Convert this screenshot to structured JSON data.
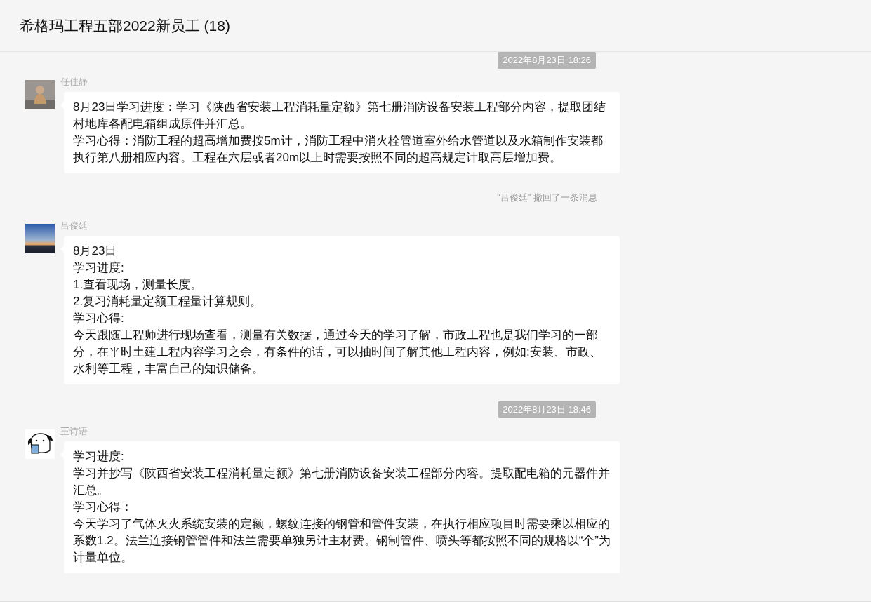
{
  "window": {
    "title": "希格玛工程五部2022新员工 (18)"
  },
  "messages": [
    {
      "kind": "time",
      "text": "2022年8月23日 18:26"
    },
    {
      "kind": "message",
      "sender": "任佳静",
      "lines": [
        "8月23日学习进度：学习《陕西省安装工程消耗量定额》第七册消防设备安装工程部分内容，提取团结村地库各配电箱组成原件并汇总。",
        "学习心得：消防工程的超高增加费按5m计，消防工程中消火栓管道室外给水管道以及水箱制作安装都执行第八册相应内容。工程在六层或者20m以上时需要按照不同的超高规定计取高层增加费。"
      ]
    },
    {
      "kind": "notice",
      "text": "\"吕俊廷\" 撤回了一条消息"
    },
    {
      "kind": "message",
      "sender": "吕俊廷",
      "lines": [
        "8月23日",
        "学习进度:",
        "1.查看现场，测量长度。",
        "2.复习消耗量定额工程量计算规则。",
        "学习心得:",
        "今天跟随工程师进行现场查看，测量有关数据，通过今天的学习了解，市政工程也是我们学习的一部分，在平时土建工程内容学习之余，有条件的话，可以抽时间了解其他工程内容，例如:安装、市政、水利等工程，丰富自己的知识储备。"
      ]
    },
    {
      "kind": "time",
      "text": "2022年8月23日 18:46"
    },
    {
      "kind": "message",
      "sender": "王诗语",
      "lines": [
        "学习进度:",
        "学习并抄写《陕西省安装工程消耗量定额》第七册消防设备安装工程部分内容。提取配电箱的元器件并汇总。",
        "学习心得：",
        "今天学习了气体灭火系统安装的定额，螺纹连接的钢管和管件安装，在执行相应项目时需要乘以相应的系数1.2。法兰连接钢管管件和法兰需要单独另计主材费。钢制管件、喷头等都按照不同的规格以“个”为计量单位。"
      ]
    }
  ]
}
